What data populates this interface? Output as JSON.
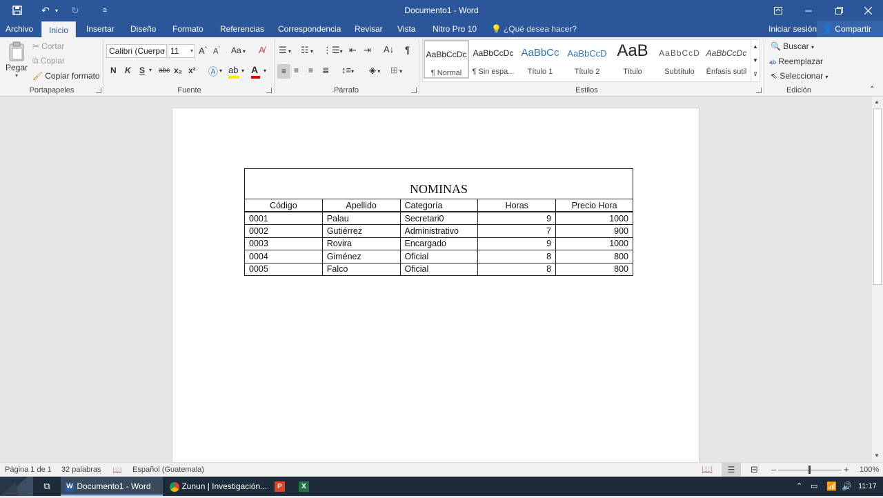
{
  "window": {
    "title": "Documento1 - Word",
    "minimize_icon": "minimize-icon",
    "restore_icon": "restore-icon",
    "close_icon": "close-icon"
  },
  "tabs": [
    {
      "label": "Archivo"
    },
    {
      "label": "Inicio"
    },
    {
      "label": "Insertar"
    },
    {
      "label": "Diseño"
    },
    {
      "label": "Formato"
    },
    {
      "label": "Referencias"
    },
    {
      "label": "Correspondencia"
    },
    {
      "label": "Revisar"
    },
    {
      "label": "Vista"
    },
    {
      "label": "Nitro Pro 10"
    }
  ],
  "active_tab": "Inicio",
  "tell_me": "¿Qué desea hacer?",
  "account": {
    "signin": "Iniciar sesión",
    "share": "Compartir"
  },
  "ribbon": {
    "clipboard": {
      "label": "Portapapeles",
      "paste": "Pegar",
      "cut": "Cortar",
      "copy": "Copiar",
      "format_painter": "Copiar formato"
    },
    "font": {
      "label": "Fuente",
      "font_name": "Calibri (Cuerpo",
      "font_size": "11",
      "change_case": "Aa",
      "bold": "N",
      "italic": "K",
      "underline": "S",
      "strike": "abc",
      "subscript": "x₂",
      "superscript": "x²"
    },
    "paragraph": {
      "label": "Párrafo"
    },
    "styles": {
      "label": "Estilos",
      "items": [
        {
          "sample": "AaBbCcDc",
          "name": "¶ Normal"
        },
        {
          "sample": "AaBbCcDc",
          "name": "¶ Sin espa..."
        },
        {
          "sample": "AaBbCc",
          "name": "Título 1"
        },
        {
          "sample": "AaBbCcD",
          "name": "Título 2"
        },
        {
          "sample": "AaB",
          "name": "Título"
        },
        {
          "sample": "AaBbCcD",
          "name": "Subtítulo"
        },
        {
          "sample": "AaBbCcDc",
          "name": "Énfasis sutil"
        }
      ]
    },
    "editing": {
      "label": "Edición",
      "find": "Buscar",
      "replace": "Reemplazar",
      "select": "Seleccionar"
    }
  },
  "document": {
    "table": {
      "title": "NOMINAS",
      "headers": [
        "Código",
        "Apellido",
        "Categoría",
        "Horas",
        "Precio Hora"
      ],
      "rows": [
        [
          "0001",
          "Palau",
          "Secretari0",
          "9",
          "1000"
        ],
        [
          "0002",
          "Gutiérrez",
          "Administrativo",
          "7",
          "900"
        ],
        [
          "0003",
          "Rovira",
          "Encargado",
          "9",
          "1000"
        ],
        [
          "0004",
          "Giménez",
          "Oficial",
          "8",
          "800"
        ],
        [
          "0005",
          "Falco",
          "Oficial",
          "8",
          "800"
        ]
      ]
    }
  },
  "statusbar": {
    "page": "Página 1 de 1",
    "words": "32 palabras",
    "language": "Español (Guatemala)",
    "zoom": "100%"
  },
  "taskbar": {
    "items": [
      {
        "label": "Documento1 - Word"
      },
      {
        "label": "Zunun | Investigación..."
      }
    ],
    "time": "11:17"
  },
  "colors": {
    "word_blue": "#2b579a",
    "ribbon_bg": "#f3f3f3",
    "taskbar": "#1d2b3a"
  }
}
